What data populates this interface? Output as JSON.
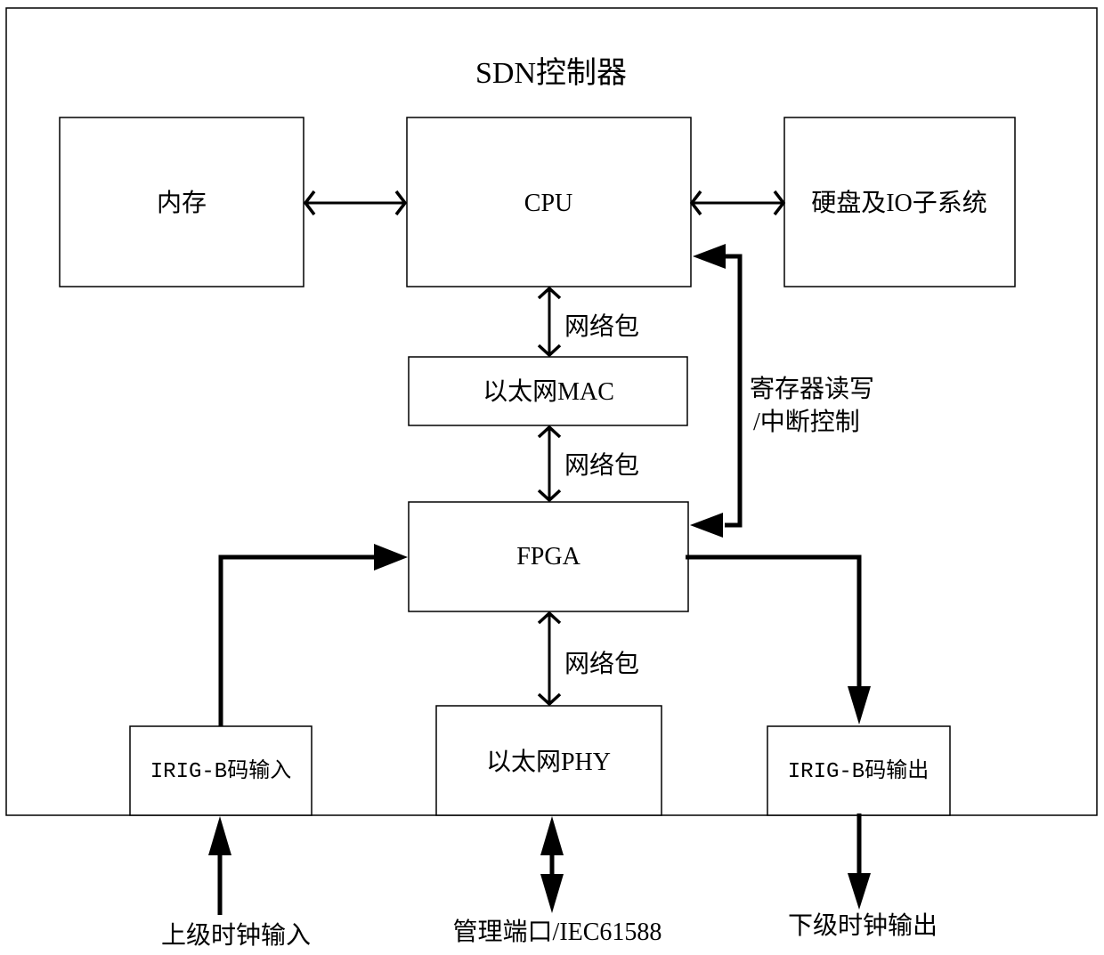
{
  "title": "SDN控制器",
  "blocks": {
    "memory": "内存",
    "cpu": "CPU",
    "storage": "硬盘及IO子系统",
    "mac": "以太网MAC",
    "fpga": "FPGA",
    "phy": "以太网PHY",
    "irig_in": "IRIG-B码输入",
    "irig_out": "IRIG-B码输出"
  },
  "edge_labels": {
    "cpu_mac": "网络包",
    "mac_fpga": "网络包",
    "fpga_phy": "网络包",
    "reg_line1": "寄存器读写",
    "reg_line2": "/中断控制"
  },
  "external": {
    "clock_in": "上级时钟输入",
    "mgmt_port": "管理端口/IEC61588",
    "clock_out": "下级时钟输出"
  }
}
